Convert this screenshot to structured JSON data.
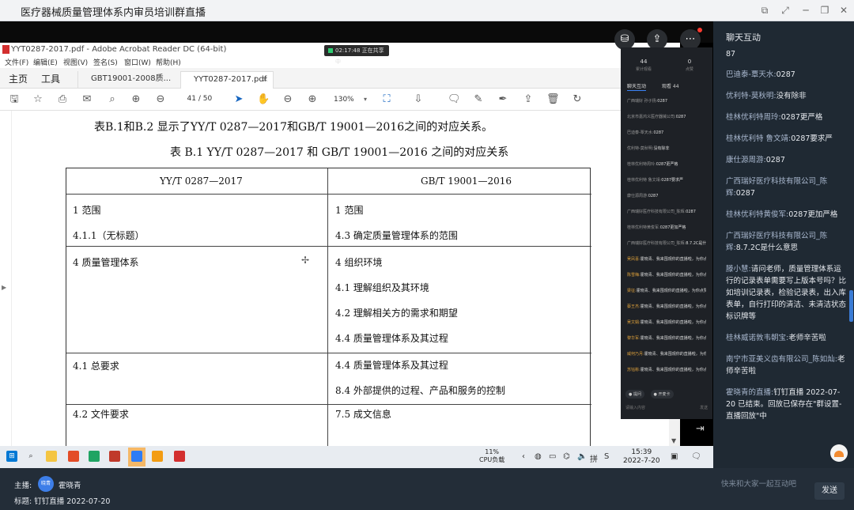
{
  "window": {
    "title": "医疗器械质量管理体系内审员培训群直播"
  },
  "acrobat": {
    "title": "YYT0287-2017.pdf - Adobe Acrobat Reader DC (64-bit)",
    "recording": "02:17:48 正在共享中",
    "menu": [
      "文件(F)",
      "编辑(E)",
      "视图(V)",
      "签名(S)",
      "窗口(W)",
      "帮助(H)"
    ],
    "home": "主页",
    "tools": "工具",
    "tabs": [
      "GBT19001-2008质...",
      "YYT0287-2017.pdf"
    ],
    "close": "×",
    "page_current": "41",
    "page_total": "/ 50",
    "zoom": "130%"
  },
  "document": {
    "intro": "表B.1和B.2 显示了YY/T 0287—2017和GB/T 19001—2016之间的对应关系。",
    "caption": "表 B.1   YY/T 0287—2017 和 GB/T 19001—2016 之间的对应关系",
    "header_left": "YY/T 0287—2017",
    "header_right": "GB/T 19001—2016",
    "left_cells": [
      "1 范围",
      "4.1.1（无标题）",
      "4 质量管理体系",
      "4.1 总要求",
      "4.2 文件要求"
    ],
    "right_cells": [
      "1 范围",
      "4.3 确定质量管理体系的范围",
      "4 组织环境",
      "4.1 理解组织及其环境",
      "4.2 理解相关方的需求和期望",
      "4.4 质量管理体系及其过程",
      "4.4 质量管理体系及其过程",
      "8.4 外部提供的过程、产品和服务的控制",
      "7.5 成文信息"
    ]
  },
  "taskbar": {
    "cpu_percent": "11%",
    "cpu_label": "CPU负载",
    "time": "15:39",
    "date": "2022-7-20"
  },
  "overlay": {
    "stat1_value": "44",
    "stat1_label": "累计观看",
    "stat2_value": "0",
    "stat2_label": "点赞",
    "tab1": "聊天互动",
    "tab2": "观看 44",
    "messages": [
      {
        "name": "广西瑞好 孙子扬:",
        "text": "0287",
        "orange": false
      },
      {
        "name": "北京市嘉鸿义医疗器械公司:",
        "text": "0287",
        "orange": false
      },
      {
        "name": "巴迪泰-覃天水:",
        "text": "0287",
        "orange": false
      },
      {
        "name": "优利特-莫秋明:",
        "text": "没有除非",
        "orange": false
      },
      {
        "name": "桂林优利特周玲:",
        "text": "0287更严格",
        "orange": false
      },
      {
        "name": "桂林优利特 鲁文靖:",
        "text": "0287要求严",
        "orange": false
      },
      {
        "name": "康仕源周游:",
        "text": "0287",
        "orange": false
      },
      {
        "name": "广西瑞好医疗科技有限公司_陈辉:",
        "text": "0287",
        "orange": false
      },
      {
        "name": "桂林优利特黄俊军:",
        "text": "0287更加严格",
        "orange": false
      },
      {
        "name": "广西瑞好医疗科技有限公司_陈辉:",
        "text": "8.7.2C是什么意思",
        "orange": false
      },
      {
        "name": "吴凤喜:",
        "text": "霍晓青、我来围观你的直播啦，为你点赞！",
        "orange": true
      },
      {
        "name": "陈雪梅:",
        "text": "霍晓青、我来围观你的直播啦，为你点赞！",
        "orange": true
      },
      {
        "name": "梁征:",
        "text": "霍晓青、我来围观你的直播啦，为你点赞！",
        "orange": true
      },
      {
        "name": "蔡王杰:",
        "text": "霍晓青、我来围观你的直播啦，为你点赞！",
        "orange": true
      },
      {
        "name": "吴文娟:",
        "text": "霍晓青、我来围观你的直播啦，为你点赞！",
        "orange": true
      },
      {
        "name": "黎华军:",
        "text": "霍晓青、我来围观你的直播啦，为你点赞！",
        "orange": true
      },
      {
        "name": "威何乃月:",
        "text": "霍晓青、我来围观你的直播啦，为你点赞！",
        "orange": true
      },
      {
        "name": "苏钰彬:",
        "text": "霍晓青、我来围观你的直播啦，为你点赞！",
        "orange": true
      }
    ],
    "btn1": "● 提问",
    "btn2": "● 开麦卡",
    "input": "请输入内容",
    "send": "发送"
  },
  "chat": {
    "header": "聊天互动",
    "m0": "87",
    "m1_name": "巴迪泰-覃天水:",
    "m1_text": "0287",
    "m2_name": "优利特-莫秋明:",
    "m2_text": "没有除非",
    "m3_name": "桂林优利特周玲:",
    "m3_text": "0287更严格",
    "m4_name": "桂林优利特 鲁文靖:",
    "m4_text": "0287要求严",
    "m5_name": "康仕源周游:",
    "m5_text": "0287",
    "m6_name": "广西瑞好医疗科技有限公司_陈辉:",
    "m6_text": "0287",
    "m7_name": "桂林优利特黄俊军:",
    "m7_text": "0287更加严格",
    "m8_name": "广西瑞好医疗科技有限公司_陈辉:",
    "m8_text": "8.7.2C是什么意思",
    "m9_name": "滕小慧:",
    "m9_text": "请问老师，质量管理体系运行的记录表单需要写上版本号吗？比如培训记录表，检验记录表，出入库表单，自行打印的清洁、未清洁状态标识牌等",
    "m10_name": "桂林威诺敦韦朝宝:",
    "m10_text": "老师辛苦啦",
    "m11_name": "南宁市亚美义齿有限公司_陈如灿:",
    "m11_text": "老师辛苦啦",
    "m12_name": "霍晓青的直播:",
    "m12_text": "钉钉直播 2022-07-20 已结束。回放已保存在\"群设置-直播回放\"中"
  },
  "footer": {
    "host_label": "主播:",
    "avatar_text": "晓青",
    "host_name": "霍晓青",
    "subject": "标题: 钉钉直播 2022-07-20",
    "input_placeholder": "快来和大家一起互动吧",
    "send": "发送"
  }
}
